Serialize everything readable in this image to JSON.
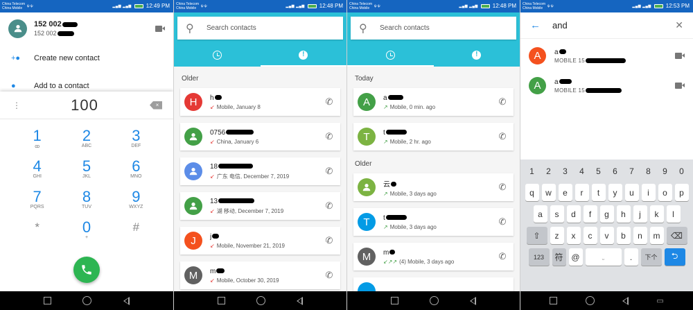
{
  "screens": {
    "s1": {
      "status": {
        "carrier1": "China Telecom",
        "carrier2": "China Mobile",
        "time": "12:49 PM"
      },
      "contact": {
        "number": "152 002",
        "number_sub": "152 002"
      },
      "rows": {
        "create": "Create new contact",
        "add": "Add to a contact"
      },
      "dialpad": {
        "digits": "100",
        "keys": [
          {
            "n": "1",
            "l": "ꝏ"
          },
          {
            "n": "2",
            "l": "ABC"
          },
          {
            "n": "3",
            "l": "DEF"
          },
          {
            "n": "4",
            "l": "GHI"
          },
          {
            "n": "5",
            "l": "JKL"
          },
          {
            "n": "6",
            "l": "MNO"
          },
          {
            "n": "7",
            "l": "PQRS"
          },
          {
            "n": "8",
            "l": "TUV"
          },
          {
            "n": "9",
            "l": "WXYZ"
          },
          {
            "n": "*",
            "l": ""
          },
          {
            "n": "0",
            "l": "+"
          },
          {
            "n": "#",
            "l": ""
          }
        ]
      }
    },
    "s2": {
      "status": {
        "carrier1": "China Telecom",
        "carrier2": "China Mobile",
        "time": "12:48 PM"
      },
      "search_placeholder": "Search contacts",
      "section_older": "Older",
      "entries": [
        {
          "letter": "H",
          "name": "h",
          "sub": "Mobile, January 8",
          "arrow": "↙"
        },
        {
          "letter": "",
          "name": "0756",
          "sub": "China, January 6",
          "arrow": "↙"
        },
        {
          "letter": "",
          "name": "18",
          "sub": "广东 电信, December 7, 2019",
          "arrow": "↙"
        },
        {
          "letter": "",
          "name": "13",
          "sub": "湖 移动, December 7, 2019",
          "arrow": "↙"
        },
        {
          "letter": "J",
          "name": "j",
          "sub": "Mobile, November 21, 2019",
          "arrow": "↙"
        },
        {
          "letter": "M",
          "name": "m",
          "sub": "Mobile, October 30, 2019",
          "arrow": "↙"
        }
      ]
    },
    "s3": {
      "status": {
        "carrier1": "China Telecom",
        "carrier2": "China Mobile",
        "time": "12:48 PM"
      },
      "search_placeholder": "Search contacts",
      "section_today": "Today",
      "section_older": "Older",
      "today": [
        {
          "letter": "A",
          "name": "a",
          "sub": "Mobile, 0 min. ago",
          "arrow": "↗"
        },
        {
          "letter": "T",
          "name": "t",
          "sub": "Mobile, 2 hr. ago",
          "arrow": "↗"
        }
      ],
      "older": [
        {
          "letter": "",
          "name": "云",
          "sub": "Mobile, 3 days ago",
          "arrow": "↗"
        },
        {
          "letter": "T",
          "name": "t",
          "sub": "Mobile, 3 days ago",
          "arrow": "↗"
        },
        {
          "letter": "M",
          "name": "m",
          "sub": "(4) Mobile, 3 days ago",
          "arrow": "↙↗↗"
        }
      ]
    },
    "s4": {
      "status": {
        "carrier1": "China Telecom",
        "carrier2": "China Mobile",
        "time": "12:53 PM"
      },
      "query": "and",
      "results": [
        {
          "letter": "A",
          "name": "a",
          "phone": "MOBILE  15"
        },
        {
          "letter": "A",
          "name": "a",
          "phone": "MOBILE  15"
        }
      ],
      "keyboard": {
        "nums": [
          "1",
          "2",
          "3",
          "4",
          "5",
          "6",
          "7",
          "8",
          "9",
          "0"
        ],
        "row1": [
          "q",
          "w",
          "e",
          "r",
          "t",
          "y",
          "u",
          "i",
          "o",
          "p"
        ],
        "row2": [
          "a",
          "s",
          "d",
          "f",
          "g",
          "h",
          "j",
          "k",
          "l"
        ],
        "row3": [
          "z",
          "x",
          "c",
          "v",
          "b",
          "n",
          "m"
        ],
        "key_123": "123",
        "key_symbol": "符",
        "key_at": "@",
        "key_dot": ".",
        "key_next": "下个"
      }
    }
  },
  "colors": {
    "teal": "#2bc0d8",
    "statusbar": "#1565c0",
    "call_green": "#2db552",
    "accent_blue": "#1e88e5"
  }
}
